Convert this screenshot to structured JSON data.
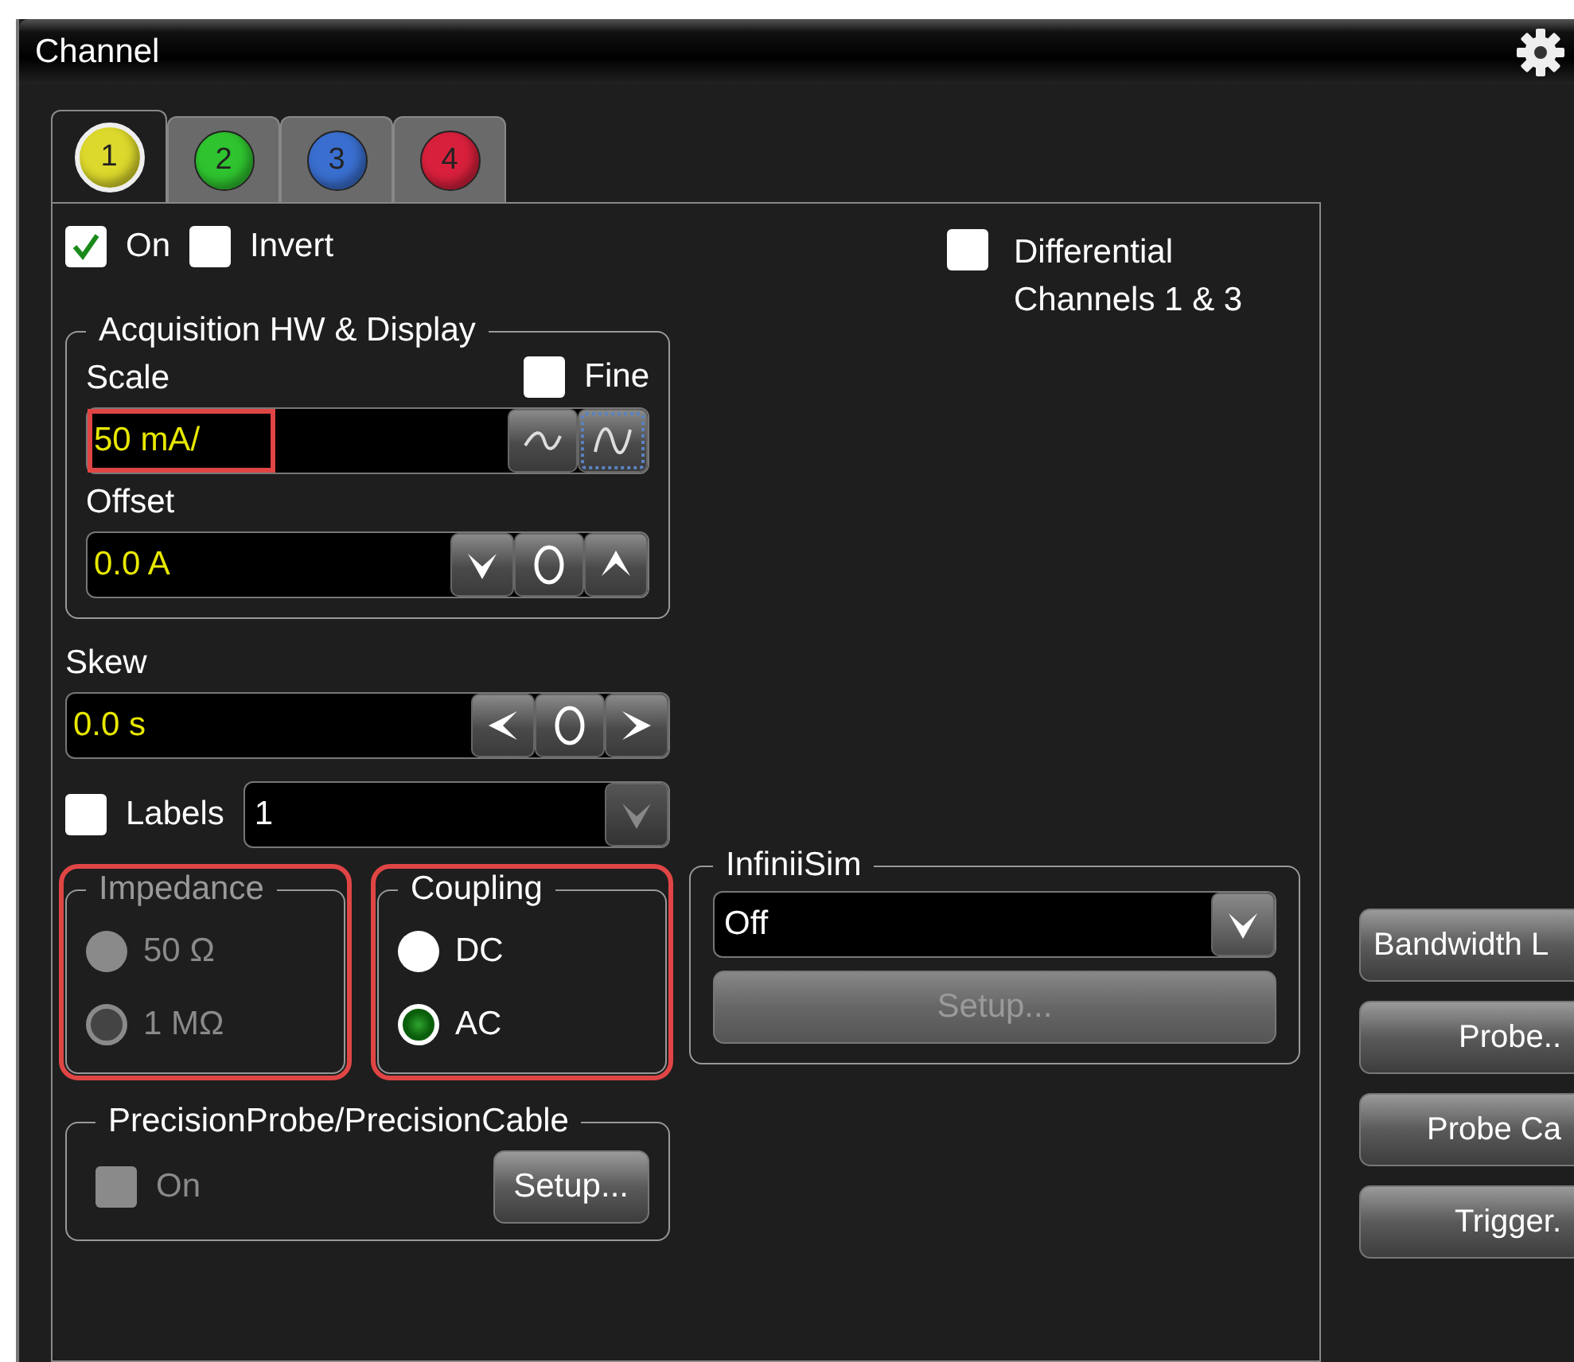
{
  "window": {
    "title": "Channel"
  },
  "tabs": [
    {
      "label": "1",
      "color": "#dcd82c",
      "selected": true
    },
    {
      "label": "2",
      "color": "#2fc42f",
      "selected": false
    },
    {
      "label": "3",
      "color": "#3a6fd0",
      "selected": false
    },
    {
      "label": "4",
      "color": "#d8203c",
      "selected": false
    }
  ],
  "on": {
    "label": "On",
    "checked": true
  },
  "invert": {
    "label": "Invert",
    "checked": false
  },
  "differential": {
    "label": "Differential Channels 1 & 3",
    "checked": false
  },
  "acquisition": {
    "title": "Acquisition HW & Display",
    "fine": {
      "label": "Fine",
      "checked": false
    },
    "scale": {
      "label": "Scale",
      "value": "50 mA/",
      "highlighted": true
    },
    "offset": {
      "label": "Offset",
      "value": "0.0 A",
      "highlighted": false
    }
  },
  "skew": {
    "label": "Skew",
    "value": "0.0 s"
  },
  "labels": {
    "label": "Labels",
    "checked": false,
    "value": "1"
  },
  "impedance": {
    "title": "Impedance",
    "disabled": true,
    "highlighted": true,
    "options": [
      {
        "label": "50 Ω",
        "selected": false
      },
      {
        "label": "1 MΩ",
        "selected": true
      }
    ]
  },
  "coupling": {
    "title": "Coupling",
    "disabled": false,
    "highlighted": true,
    "options": [
      {
        "label": "DC",
        "selected": false
      },
      {
        "label": "AC",
        "selected": true
      }
    ]
  },
  "precision": {
    "title": "PrecisionProbe/PrecisionCable",
    "on": {
      "label": "On",
      "checked": false,
      "disabled": true
    },
    "setup": {
      "label": "Setup...",
      "disabled": false
    }
  },
  "infiniisim": {
    "title": "InfiniiSim",
    "value": "Off",
    "setup": {
      "label": "Setup...",
      "disabled": true
    }
  },
  "side_buttons": [
    "Bandwidth L",
    "Probe..",
    "Probe Ca",
    "Trigger."
  ]
}
